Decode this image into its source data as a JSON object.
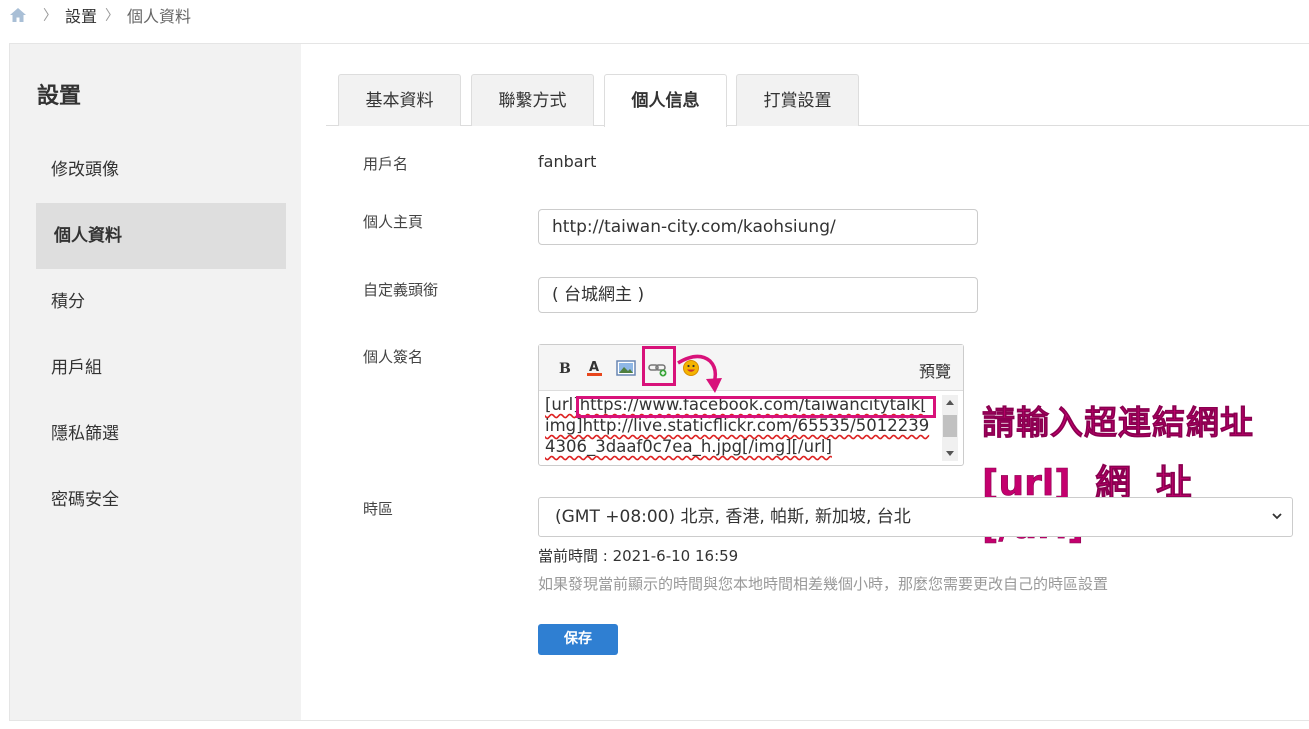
{
  "breadcrumb": {
    "items": [
      "設置",
      "個人資料"
    ]
  },
  "sidebar": {
    "title": "設置",
    "items": [
      {
        "label": "修改頭像"
      },
      {
        "label": "個人資料"
      },
      {
        "label": "積分"
      },
      {
        "label": "用戶組"
      },
      {
        "label": "隱私篩選"
      },
      {
        "label": "密碼安全"
      }
    ],
    "active_index": 1
  },
  "tabs": {
    "items": [
      {
        "label": "基本資料"
      },
      {
        "label": "聯繫方式"
      },
      {
        "label": "個人信息"
      },
      {
        "label": "打賞設置"
      }
    ],
    "active_index": 2
  },
  "form": {
    "username": {
      "label": "用戶名",
      "value": "fanbart"
    },
    "homepage": {
      "label": "個人主頁",
      "value": "http://taiwan-city.com/kaohsiung/"
    },
    "custom_title": {
      "label": "自定義頭銜",
      "value": "( 台城網主 )"
    },
    "signature": {
      "label": "個人簽名",
      "preview_label": "預覽",
      "toolbar_icons": [
        "bold-icon",
        "font-color-icon",
        "image-icon",
        "link-icon",
        "emoji-icon"
      ],
      "lines": [
        "[url]https://www.facebook.com/taiwancitytalk[",
        "img]http://live.staticflickr.com/65535/5012239",
        "4306_3daaf0c7ea_h.jpg[/img][/url]"
      ]
    },
    "timezone": {
      "label": "時區",
      "selected": "(GMT +08:00) 北京, 香港, 帕斯, 新加坡, 台北",
      "current_time": "當前時間 : 2021-6-10 16:59",
      "hint": "如果發現當前顯示的時間與您本地時間相差幾個小時，那麼您需要更改自己的時區設置"
    },
    "save_label": "保存"
  },
  "annotation": {
    "line1": "請輸入超連結網址",
    "line2": "[url] 網 址 [/url]",
    "color": "#c4006e"
  },
  "colors": {
    "accent": "#2f7fd2",
    "highlight": "#d8127a",
    "sidebar_bg": "#f2f2f2"
  }
}
